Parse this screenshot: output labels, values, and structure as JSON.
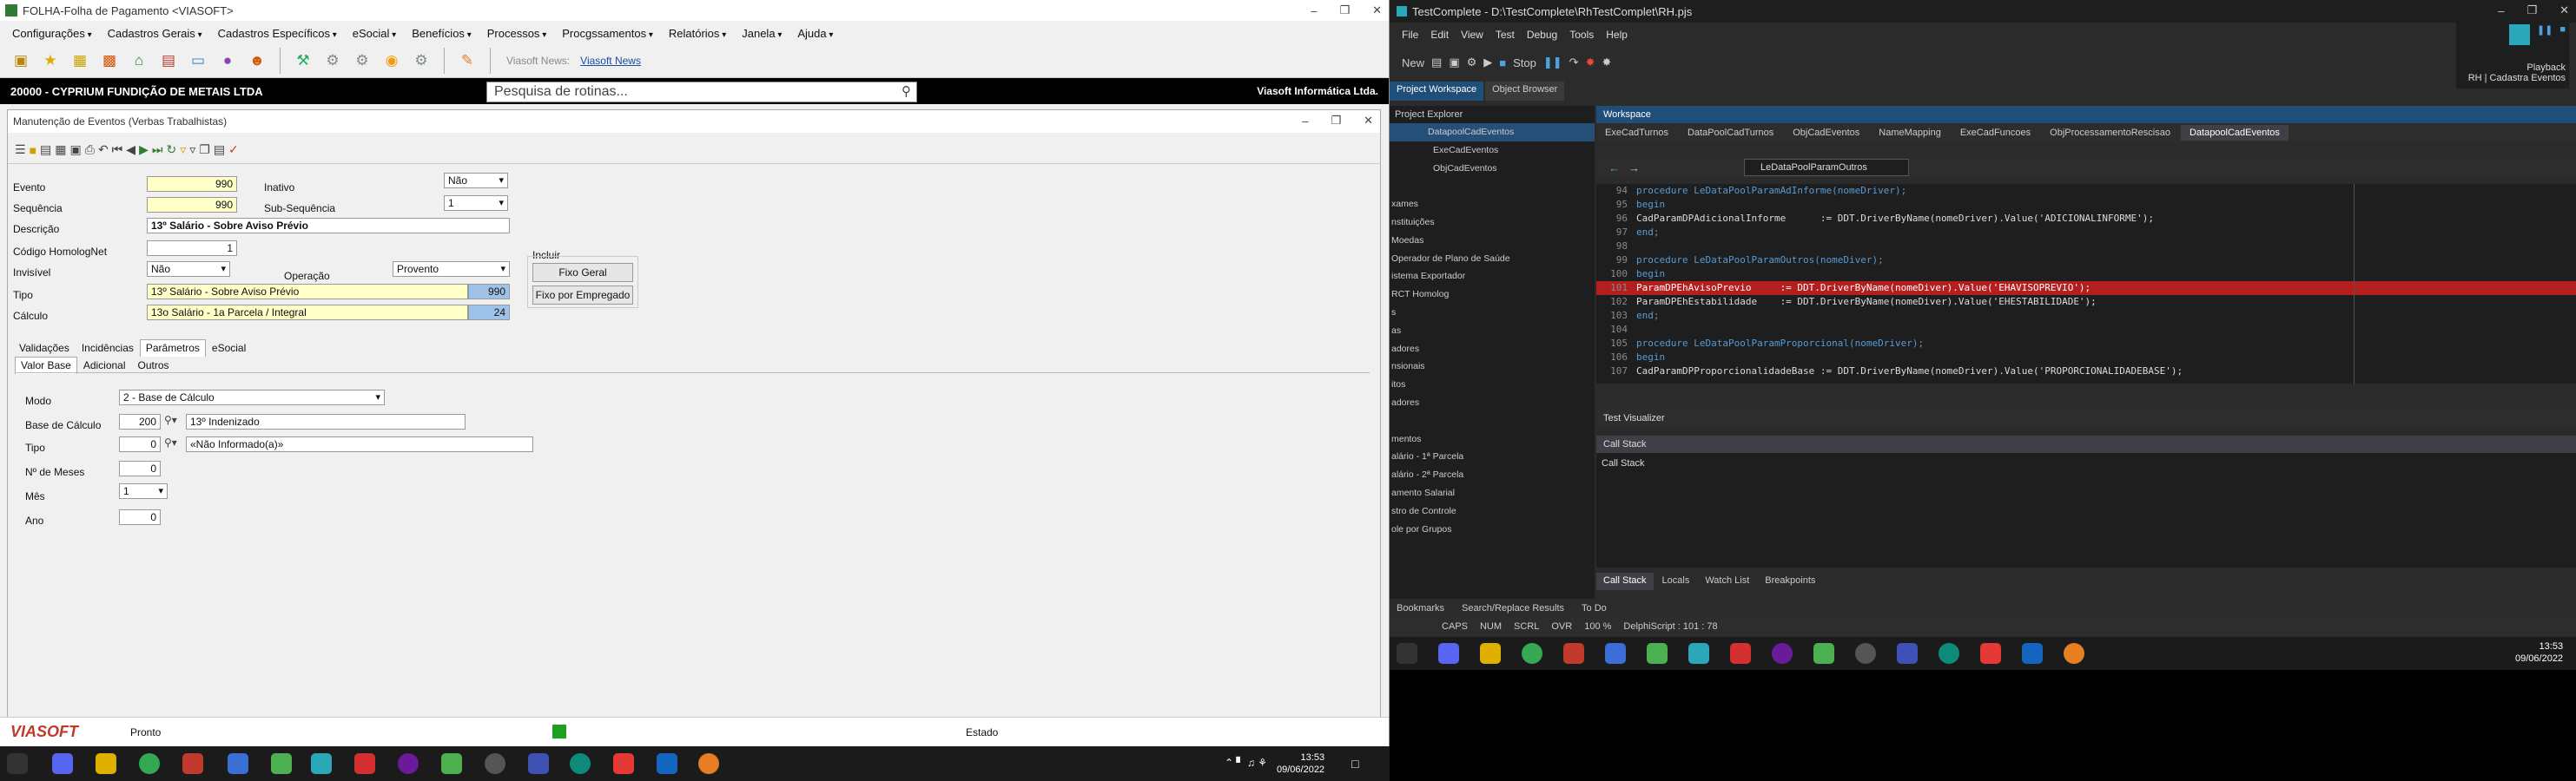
{
  "left_app": {
    "title": "FOLHA-Folha de Pagamento <VIASOFT>",
    "menus": [
      "Configurações",
      "Cadastros Gerais",
      "Cadastros Específicos",
      "eSocial",
      "Benefícios",
      "Processos",
      "Procgssamentos",
      "Relatórios",
      "Janela",
      "Ajuda"
    ],
    "viasoft_news_label": "Viasoft News:",
    "viasoft_news_link": "Viasoft News",
    "company": "20000 - CYPRIUM FUNDIÇÃO DE METAIS LTDA",
    "search_placeholder": "Pesquisa de rotinas...",
    "vendor": "Viasoft Informática Ltda.",
    "form": {
      "title": "Manutenção de Eventos (Verbas Trabalhistas)",
      "evento_label": "Evento",
      "evento": "990",
      "inativo_label": "Inativo",
      "inativo": "Não",
      "sequencia_label": "Sequência",
      "sequencia": "990",
      "subsequencia_label": "Sub-Sequência",
      "subsequencia": "1",
      "descricao_label": "Descrição",
      "descricao": "13º Salário - Sobre Aviso Prévio",
      "codigo_homolognet_label": "Código HomologNet",
      "codigo_homolognet": "1",
      "invisivel_label": "Invisível",
      "invisivel": "Não",
      "operacao_label": "Operação",
      "operacao": "Provento",
      "incluir_label": "Incluir",
      "fixo_geral": "Fixo Geral",
      "fixo_empregado": "Fixo por Empregado",
      "tipo_label": "Tipo",
      "tipo": "13º Salário - Sobre Aviso Prévio",
      "tipo_code": "990",
      "calculo_label": "Cálculo",
      "calculo": "13o Salário - 1a Parcela / Integral",
      "calculo_code": "24",
      "tabs": [
        "Validações",
        "Incidências",
        "Parâmetros",
        "eSocial"
      ],
      "subtabs": [
        "Valor Base",
        "Adicional",
        "Outros"
      ],
      "modo_label": "Modo",
      "modo": "2 - Base de Cálculo",
      "base_label": "Base de Cálculo",
      "base_code": "200",
      "base_desc": "13º Indenizado",
      "tipo2_label": "Tipo",
      "tipo2_code": "0",
      "tipo2_desc": "«Não Informado(a)»",
      "meses_label": "Nº de Meses",
      "meses": "0",
      "mes_label": "Mês",
      "mes": "1",
      "ano_label": "Ano",
      "ano": "0"
    },
    "status": {
      "brand": "VIASOFT",
      "state": "Pronto",
      "estado": "Estado"
    }
  },
  "taskbar_left": {
    "time": "13:53",
    "date": "09/06/2022"
  },
  "right_app": {
    "title": "TestComplete - D:\\TestComplete\\RhTestComplet\\RH.pjs",
    "menus": [
      "File",
      "Edit",
      "View",
      "Test",
      "Debug",
      "Tools",
      "Help"
    ],
    "new_label": "New",
    "stop_label": "Stop",
    "playback_label": "Playback",
    "playback_sub": "RH | Cadastra Eventos",
    "workspace_tabs": [
      "Project Workspace",
      "Object Browser"
    ],
    "project_explorer": "Project Explorer",
    "workspace": "Workspace",
    "editor_tabs": [
      "ExeCadTurnos",
      "DataPoolCadTurnos",
      "ObjCadEventos",
      "NameMapping",
      "ExeCadFuncoes",
      "ObjProcessamentoRescisao",
      "DatapoolCadEventos"
    ],
    "routine_combo": "LeDataPoolParamOutros",
    "tree": [
      "DatapoolCadEventos",
      "ExeCadEventos",
      "ObjCadEventos",
      "",
      "xames",
      "nstituições",
      "Moedas",
      "Operador de Plano de Saúde",
      "istema Exportador",
      "RCT Homolog",
      "s",
      "as",
      "adores",
      "nsionais",
      "itos",
      "adores",
      "",
      "mentos",
      "alário - 1ª Parcela",
      "alário - 2ª Parcela",
      "amento Salarial",
      "stro de Controle",
      "ole por Grupos"
    ],
    "code_lines": [
      {
        "n": "94",
        "t": "procedure LeDataPoolParamAdInforme(nomeDriver);"
      },
      {
        "n": "95",
        "t": "begin"
      },
      {
        "n": "96",
        "t": "CadParamDPAdicionalInforme      := DDT.DriverByName(nomeDriver).Value('ADICIONALINFORME');"
      },
      {
        "n": "97",
        "t": "end;"
      },
      {
        "n": "98",
        "t": ""
      },
      {
        "n": "99",
        "t": "procedure LeDataPoolParamOutros(nomeDiver);"
      },
      {
        "n": "100",
        "t": "begin"
      },
      {
        "n": "101",
        "t": "ParamDPEhAvisoPrevio     := DDT.DriverByName(nomeDiver).Value('EHAVISOPREVIO');"
      },
      {
        "n": "102",
        "t": "ParamDPEhEstabilidade    := DDT.DriverByName(nomeDiver).Value('EHESTABILIDADE');"
      },
      {
        "n": "103",
        "t": "end;"
      },
      {
        "n": "104",
        "t": ""
      },
      {
        "n": "105",
        "t": "procedure LeDataPoolParamProporcional(nomeDriver);"
      },
      {
        "n": "106",
        "t": "begin"
      },
      {
        "n": "107",
        "t": "CadParamDPProporcionalidadeBase := DDT.DriverByName(nomeDriver).Value('PROPORCIONALIDADEBASE');"
      }
    ],
    "test_visualizer": "Test Visualizer",
    "call_stack": "Call Stack",
    "call_stack_inner": "Call Stack",
    "bottom_tabs": [
      "Call Stack",
      "Locals",
      "Watch List",
      "Breakpoints"
    ],
    "left_bottom_tabs": [
      "Bookmarks",
      "Search/Replace Results",
      "To Do"
    ],
    "status": [
      "CAPS",
      "NUM",
      "SCRL",
      "OVR",
      "100 %",
      "DelphiScript :  101 :  78"
    ]
  },
  "taskbar_right": {
    "time": "13:53",
    "date": "09/06/2022"
  }
}
